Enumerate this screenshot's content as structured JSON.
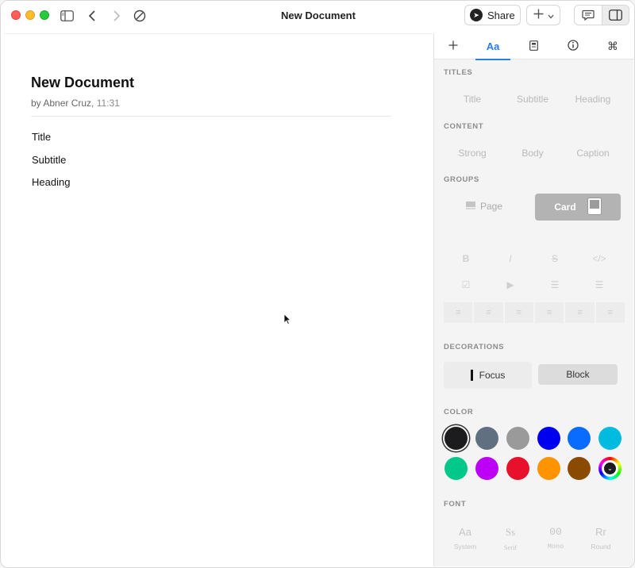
{
  "window": {
    "title": "New Document"
  },
  "toolbar": {
    "share_label": "Share"
  },
  "document": {
    "title": "New Document",
    "author": "by Abner Cruz,",
    "time": "11:31",
    "lines": [
      "Title",
      "Subtitle",
      "Heading"
    ]
  },
  "panel": {
    "tabs": [
      "+",
      "Aa",
      "document-icon",
      "info-icon",
      "command-icon"
    ],
    "active_tab": "Aa",
    "sections": {
      "titles": {
        "label": "TITLES",
        "options": [
          "Title",
          "Subtitle",
          "Heading"
        ]
      },
      "content": {
        "label": "CONTENT",
        "options": [
          "Strong",
          "Body",
          "Caption"
        ]
      },
      "groups": {
        "label": "GROUPS",
        "options": [
          "Page",
          "Card"
        ],
        "selected": "Card"
      },
      "decorations": {
        "label": "DECORATIONS",
        "options": [
          "Focus",
          "Block"
        ]
      },
      "color": {
        "label": "COLOR",
        "swatches": [
          "#1c1c1e",
          "#607080",
          "#9a9a9a",
          "#0000f0",
          "#0a6cff",
          "#00bbe0",
          "#00c88a",
          "#bb00f5",
          "#e8102a",
          "#ff9400",
          "#8a4a00",
          "custom"
        ],
        "selected": "#1c1c1e"
      },
      "font": {
        "label": "FONT",
        "options": [
          {
            "glyph": "Aa",
            "name": "System"
          },
          {
            "glyph": "Ss",
            "name": "Serif"
          },
          {
            "glyph": "00",
            "name": "Mono"
          },
          {
            "glyph": "Rr",
            "name": "Round"
          }
        ]
      }
    }
  },
  "colors": {
    "accent": "#2a7de1"
  }
}
